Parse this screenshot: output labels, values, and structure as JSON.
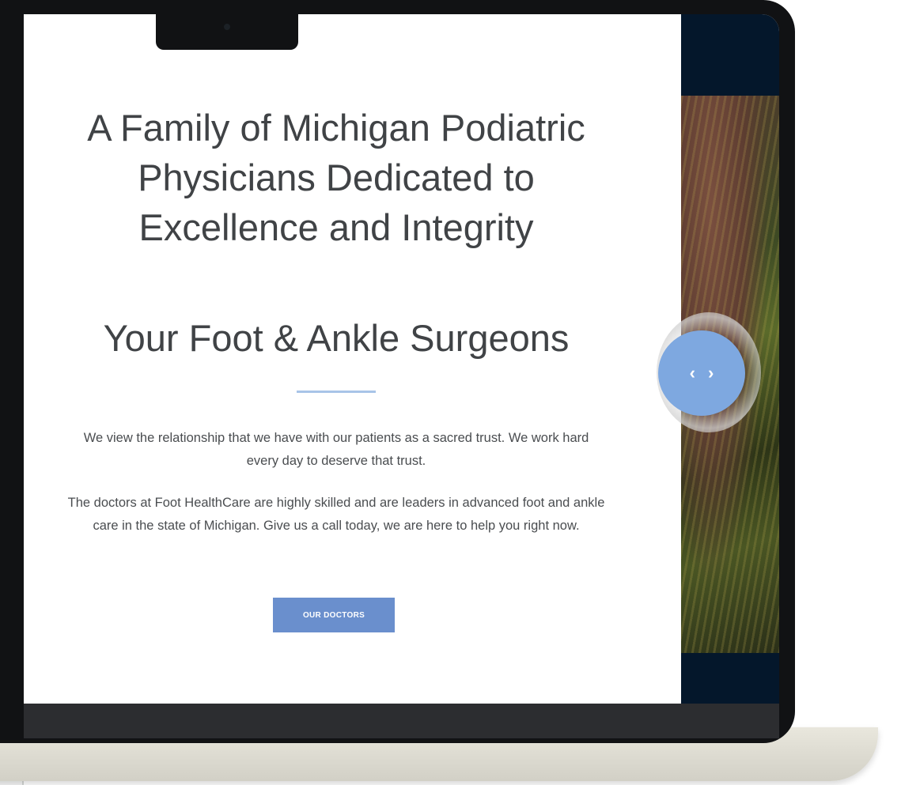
{
  "hero": {
    "headline": "A Family of Michigan Podiatric Physicians Dedicated to Excellence and Integrity",
    "subheadline": "Your Foot & Ankle Surgeons",
    "paragraph_1": "We view the relationship that we have with our patients as a sacred trust. We work hard every day to deserve that trust.",
    "paragraph_2": "The doctors at Foot HealthCare are highly skilled and are leaders in advanced foot and ankle care in the state of Michigan. Give us a call today, we are here to help you right now.",
    "cta_label": "OUR DOCTORS"
  },
  "slider": {
    "prev_glyph": "‹",
    "next_glyph": "›",
    "accent_color": "#7ea8e0"
  },
  "colors": {
    "primary_button": "#6a8fcd",
    "divider": "#a8c4e8",
    "dark_navy": "#04172b"
  }
}
